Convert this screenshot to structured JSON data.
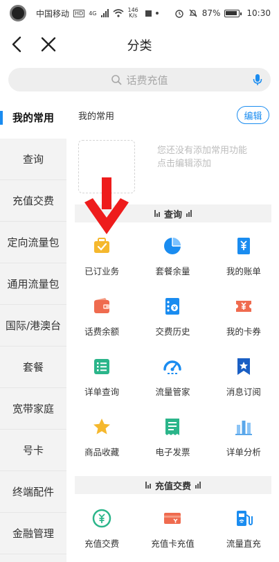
{
  "status_bar": {
    "carrier": "中国移动",
    "hd": "HD",
    "net": "4G",
    "speed_value": "146",
    "speed_unit": "K/s",
    "battery": "87%",
    "time": "10:30"
  },
  "header": {
    "title": "分类"
  },
  "search": {
    "placeholder": "话费充值"
  },
  "sidebar": {
    "items": [
      {
        "label": "我的常用"
      },
      {
        "label": "查询"
      },
      {
        "label": "充值交费"
      },
      {
        "label": "定向流量包"
      },
      {
        "label": "通用流量包"
      },
      {
        "label": "国际/港澳台"
      },
      {
        "label": "套餐"
      },
      {
        "label": "宽带家庭"
      },
      {
        "label": "号卡"
      },
      {
        "label": "终端配件"
      },
      {
        "label": "金融管理"
      }
    ]
  },
  "favorites": {
    "title": "我的常用",
    "edit_label": "编辑",
    "empty_line1": "您还没有添加常用功能",
    "empty_line2": "点击编辑添加"
  },
  "query_section": {
    "title": "查询",
    "items": [
      {
        "label": "已订业务",
        "icon": "briefcase-check-icon",
        "color": "#f5b82e"
      },
      {
        "label": "套餐余量",
        "icon": "pie-chart-icon",
        "color": "#1a8cf0"
      },
      {
        "label": "我的账单",
        "icon": "yuan-bill-icon",
        "color": "#1a8cf0"
      },
      {
        "label": "话费余额",
        "icon": "wallet-icon",
        "color": "#ef6b4f"
      },
      {
        "label": "交费历史",
        "icon": "payment-history-icon",
        "color": "#1a8cf0"
      },
      {
        "label": "我的卡券",
        "icon": "coupon-icon",
        "color": "#ef6b4f"
      },
      {
        "label": "详单查询",
        "icon": "list-detail-icon",
        "color": "#2bb58a"
      },
      {
        "label": "流量管家",
        "icon": "speedometer-icon",
        "color": "#1a8cf0"
      },
      {
        "label": "消息订阅",
        "icon": "bookmark-star-icon",
        "color": "#1a8cf0"
      },
      {
        "label": "商品收藏",
        "icon": "star-icon",
        "color": "#f5b82e"
      },
      {
        "label": "电子发票",
        "icon": "invoice-icon",
        "color": "#2bb58a"
      },
      {
        "label": "详单分析",
        "icon": "bar-chart-icon",
        "color": "#5aa7ea"
      }
    ]
  },
  "recharge_section": {
    "title": "充值交费",
    "items": [
      {
        "label": "充值交费",
        "icon": "yuan-circle-icon",
        "color": "#2bb58a"
      },
      {
        "label": "充值卡充值",
        "icon": "recharge-card-icon",
        "color": "#ef6b4f"
      },
      {
        "label": "流量直充",
        "icon": "fuel-pump-icon",
        "color": "#1a8cf0"
      }
    ]
  },
  "annotation": {
    "color": "#ee1c1c"
  }
}
